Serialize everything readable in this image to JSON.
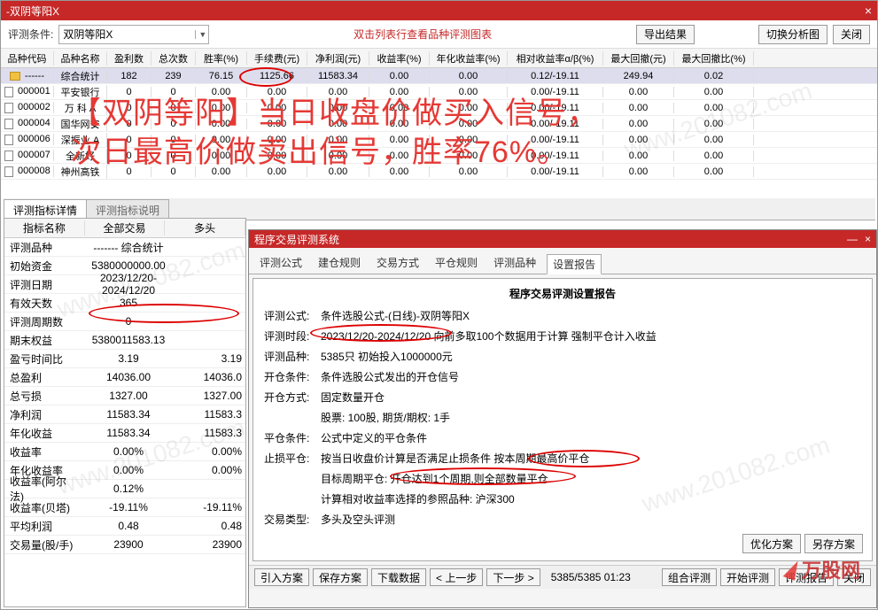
{
  "window_title": "-双阴等阳X",
  "toolbar": {
    "label": "评测条件:",
    "combo_value": "双阴等阳X",
    "hint": "双击列表行查看品种评测图表",
    "export_btn": "导出结果",
    "switch_btn": "切换分析图",
    "close_btn": "关闭"
  },
  "grid_headers": [
    "品种代码",
    "品种名称",
    "盈利数",
    "总次数",
    "胜率(%)",
    "手续费(元)",
    "净利润(元)",
    "收益率(%)",
    "年化收益率(%)",
    "相对收益率α/β(%)",
    "最大回撤(元)",
    "最大回撤比(%)"
  ],
  "grid_rows": [
    {
      "code": "------",
      "name": "综合统计",
      "c": [
        "182",
        "239",
        "76.15",
        "1125.66",
        "11583.34",
        "0.00",
        "0.00",
        "0.12/-19.11",
        "249.94",
        "0.02"
      ],
      "comb": true
    },
    {
      "code": "000001",
      "name": "平安银行",
      "c": [
        "0",
        "0",
        "0.00",
        "0.00",
        "0.00",
        "0.00",
        "0.00",
        "0.00/-19.11",
        "0.00",
        "0.00"
      ]
    },
    {
      "code": "000002",
      "name": "万 科 A",
      "c": [
        "0",
        "0",
        "0.00",
        "0.00",
        "0.00",
        "0.00",
        "0.00",
        "0.00/-19.11",
        "0.00",
        "0.00"
      ]
    },
    {
      "code": "000004",
      "name": "国华网安",
      "c": [
        "0",
        "0",
        "0.00",
        "0.00",
        "0.00",
        "0.00",
        "0.00",
        "0.00/-19.11",
        "0.00",
        "0.00"
      ]
    },
    {
      "code": "000006",
      "name": "深振业 A",
      "c": [
        "0",
        "0",
        "0.00",
        "0.00",
        "0.00",
        "0.00",
        "0.00",
        "0.00/-19.11",
        "0.00",
        "0.00"
      ]
    },
    {
      "code": "000007",
      "name": "全新好",
      "c": [
        "0",
        "0",
        "0.00",
        "0.00",
        "0.00",
        "0.00",
        "0.00",
        "0.00/-19.11",
        "0.00",
        "0.00"
      ]
    },
    {
      "code": "000008",
      "name": "神州高铁",
      "c": [
        "0",
        "0",
        "0.00",
        "0.00",
        "0.00",
        "0.00",
        "0.00",
        "0.00/-19.11",
        "0.00",
        "0.00"
      ]
    }
  ],
  "overlay_line1": "【双阴等阳】当日收盘价做买入信号，",
  "overlay_line2": "次日最高价做卖出信号，胜率76%。",
  "detail_tabs": [
    "评测指标详情",
    "评测指标说明"
  ],
  "left_headers": [
    "指标名称",
    "全部交易",
    "多头"
  ],
  "left_rows": [
    [
      "评测品种",
      "------- 综合统计",
      ""
    ],
    [
      "初始资金",
      "5380000000.00",
      ""
    ],
    [
      "评测日期",
      "2023/12/20-2024/12/20",
      ""
    ],
    [
      "有效天数",
      "365",
      ""
    ],
    [
      "评测周期数",
      "0",
      ""
    ],
    [
      "期末权益",
      "538001158​3.13",
      ""
    ],
    [
      "盈亏时间比",
      "3.19",
      "3.19"
    ],
    [
      "总盈利",
      "14036.00",
      "14036.0"
    ],
    [
      "总亏损",
      "1327.00",
      "1327.00"
    ],
    [
      "净利润",
      "11583.34",
      "11583.3"
    ],
    [
      "年化收益",
      "11583.34",
      "11583.3"
    ],
    [
      "收益率",
      "0.00%",
      "0.00%"
    ],
    [
      "年化收益率",
      "0.00%",
      "0.00%"
    ],
    [
      "收益率(阿尔法)",
      "0.12%",
      ""
    ],
    [
      "收益率(贝塔)",
      "-19.11%",
      "-19.11%"
    ],
    [
      "平均利润",
      "0.48",
      "0.48"
    ],
    [
      "交易量(股/手)",
      "23900",
      "23900"
    ]
  ],
  "sub_window_title": "程序交易评测系统",
  "sub_tabs": [
    "评测公式",
    "建仓规则",
    "交易方式",
    "平仓规则",
    "评测品种",
    "设置报告"
  ],
  "report": {
    "title": "程序交易评测设置报告",
    "lines": [
      {
        "k": "评测公式:",
        "v": "条件选股公式-(日线)-双阴等阳X"
      },
      {
        "k": "评测时段:",
        "v": "2023/12/20-2024/12/20 向前多取100个数据用于计算 强制平仓计入收益"
      },
      {
        "k": "评测品种:",
        "v": "5385只 初始投入1000000元"
      },
      {
        "k": "开仓条件:",
        "v": "条件选股公式发出的开仓信号"
      },
      {
        "k": "开仓方式:",
        "v": "固定数量开仓"
      },
      {
        "k": "",
        "v": "股票: 100股, 期货/期权: 1手"
      },
      {
        "k": "平仓条件:",
        "v": "公式中定义的平仓条件"
      },
      {
        "k": "止损平仓:",
        "v": "按当日收盘价计算是否满足止损条件 按本周期最高价平仓"
      },
      {
        "k": "",
        "v": "目标周期平仓: 开仓达到1个周期,则全部数量平仓"
      },
      {
        "k": "",
        "v": "计算相对收益率选择的参照品种: 沪深300"
      },
      {
        "k": "交易类型:",
        "v": "多头及空头评测"
      }
    ]
  },
  "bottom_bar": {
    "btns_left": [
      "引入方案",
      "保存方案",
      "下载数据",
      "< 上一步",
      "下一步 >"
    ],
    "status": "5385/5385 01:23",
    "btns_right": [
      "组合评测",
      "开始评测",
      "评测报告",
      "关闭"
    ],
    "top_right": [
      "优化方案",
      "另存方案"
    ]
  },
  "logo_text": "万股网",
  "watermark": "www.201082.com"
}
